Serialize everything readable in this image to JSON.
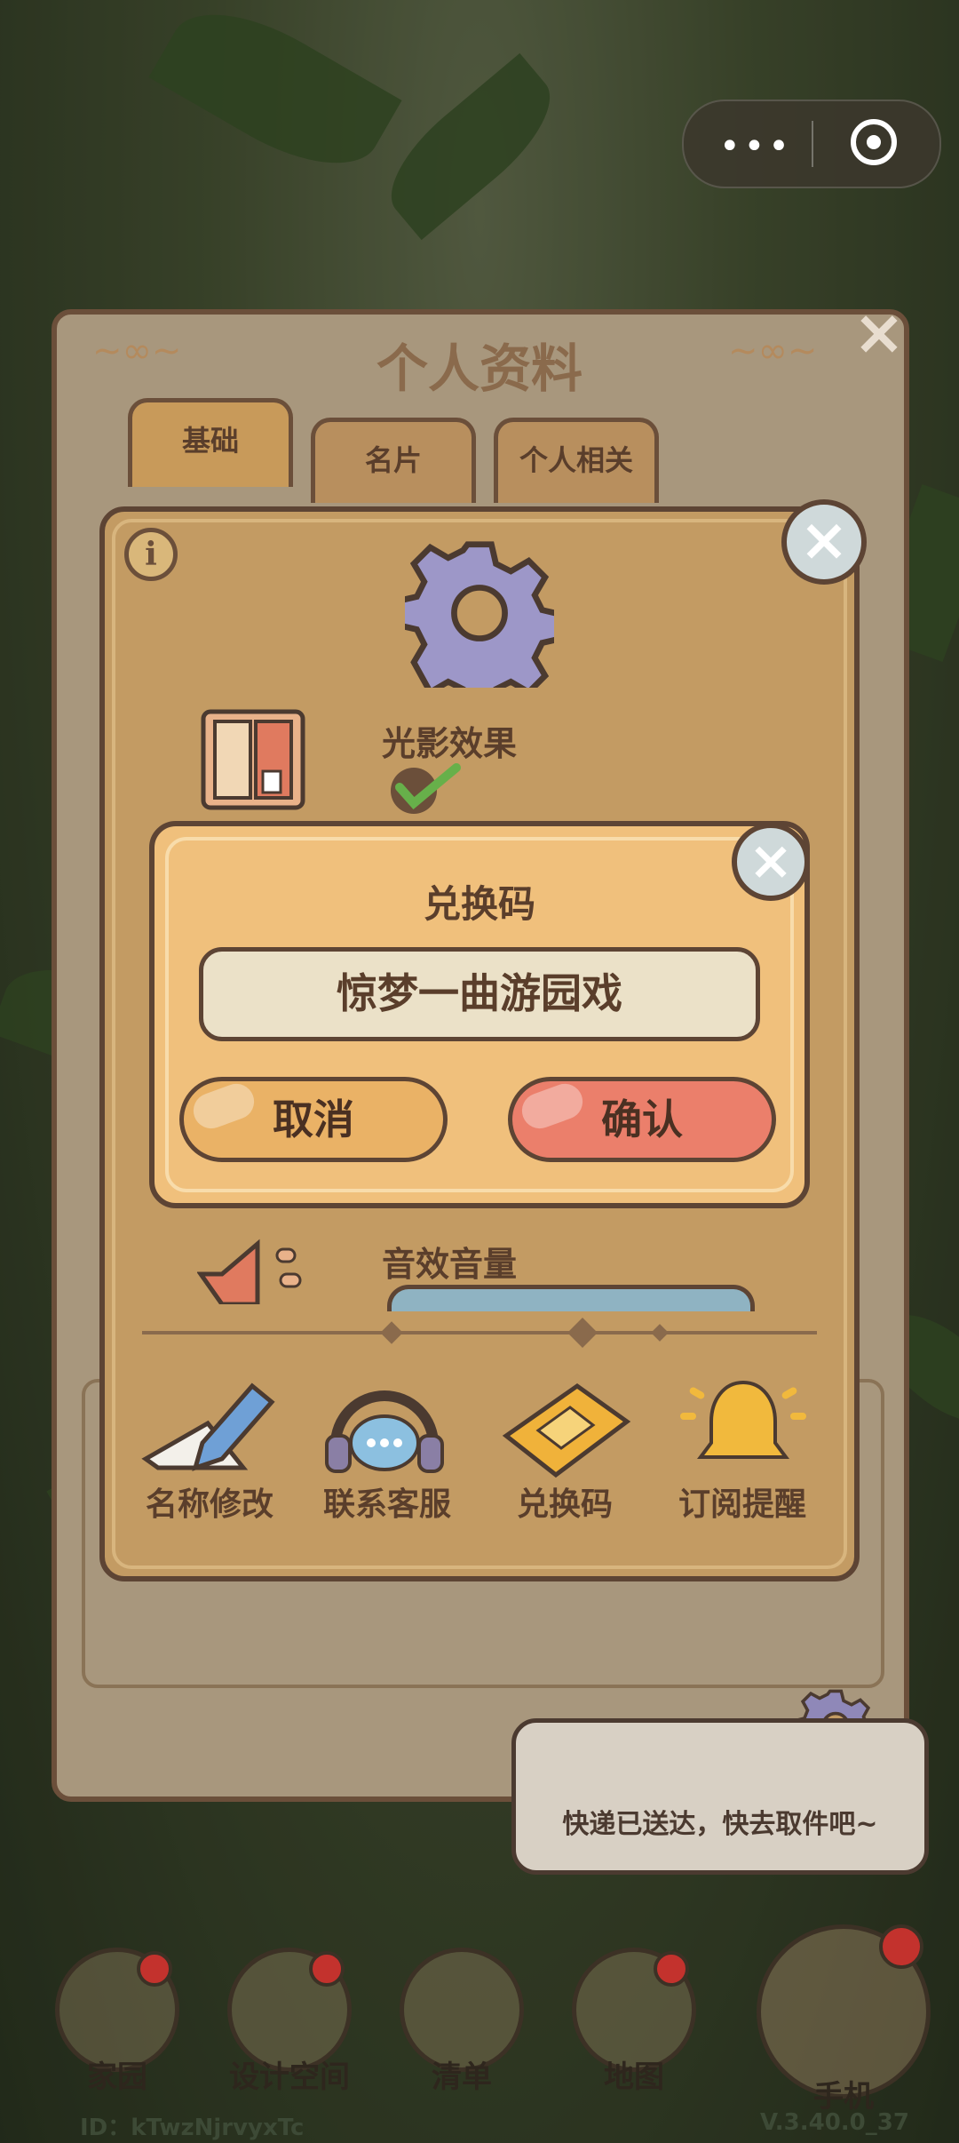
{
  "panel": {
    "title": "个人资料",
    "tabs": [
      {
        "label": "基础",
        "active": true
      },
      {
        "label": "名片",
        "active": false
      },
      {
        "label": "个人相关",
        "active": false
      }
    ]
  },
  "settings": {
    "light_label": "光影效果",
    "light_checked": true,
    "sound_label": "音效音量",
    "actions": [
      {
        "label": "名称修改",
        "icon": "pencil-paper-icon"
      },
      {
        "label": "联系客服",
        "icon": "headset-icon"
      },
      {
        "label": "兑换码",
        "icon": "ticket-icon"
      },
      {
        "label": "订阅提醒",
        "icon": "bell-icon"
      }
    ]
  },
  "redeem": {
    "title": "兑换码",
    "code_value": "惊梦一曲游园戏",
    "cancel_label": "取消",
    "confirm_label": "确认"
  },
  "bubble": {
    "text": "快递已送达，快去取件吧~"
  },
  "nav": [
    {
      "label": "家园"
    },
    {
      "label": "设计空间"
    },
    {
      "label": "清单"
    },
    {
      "label": "地图"
    },
    {
      "label": "手机"
    }
  ],
  "footer": {
    "user_id": "ID：kTwzNjrvyxTc",
    "version": "V.3.40.0_37"
  },
  "colors": {
    "cancel": "#eab266",
    "confirm": "#eb7f6b",
    "dialog": "#f0c07c",
    "settings": "#c39b63",
    "outline": "#5d4434"
  }
}
